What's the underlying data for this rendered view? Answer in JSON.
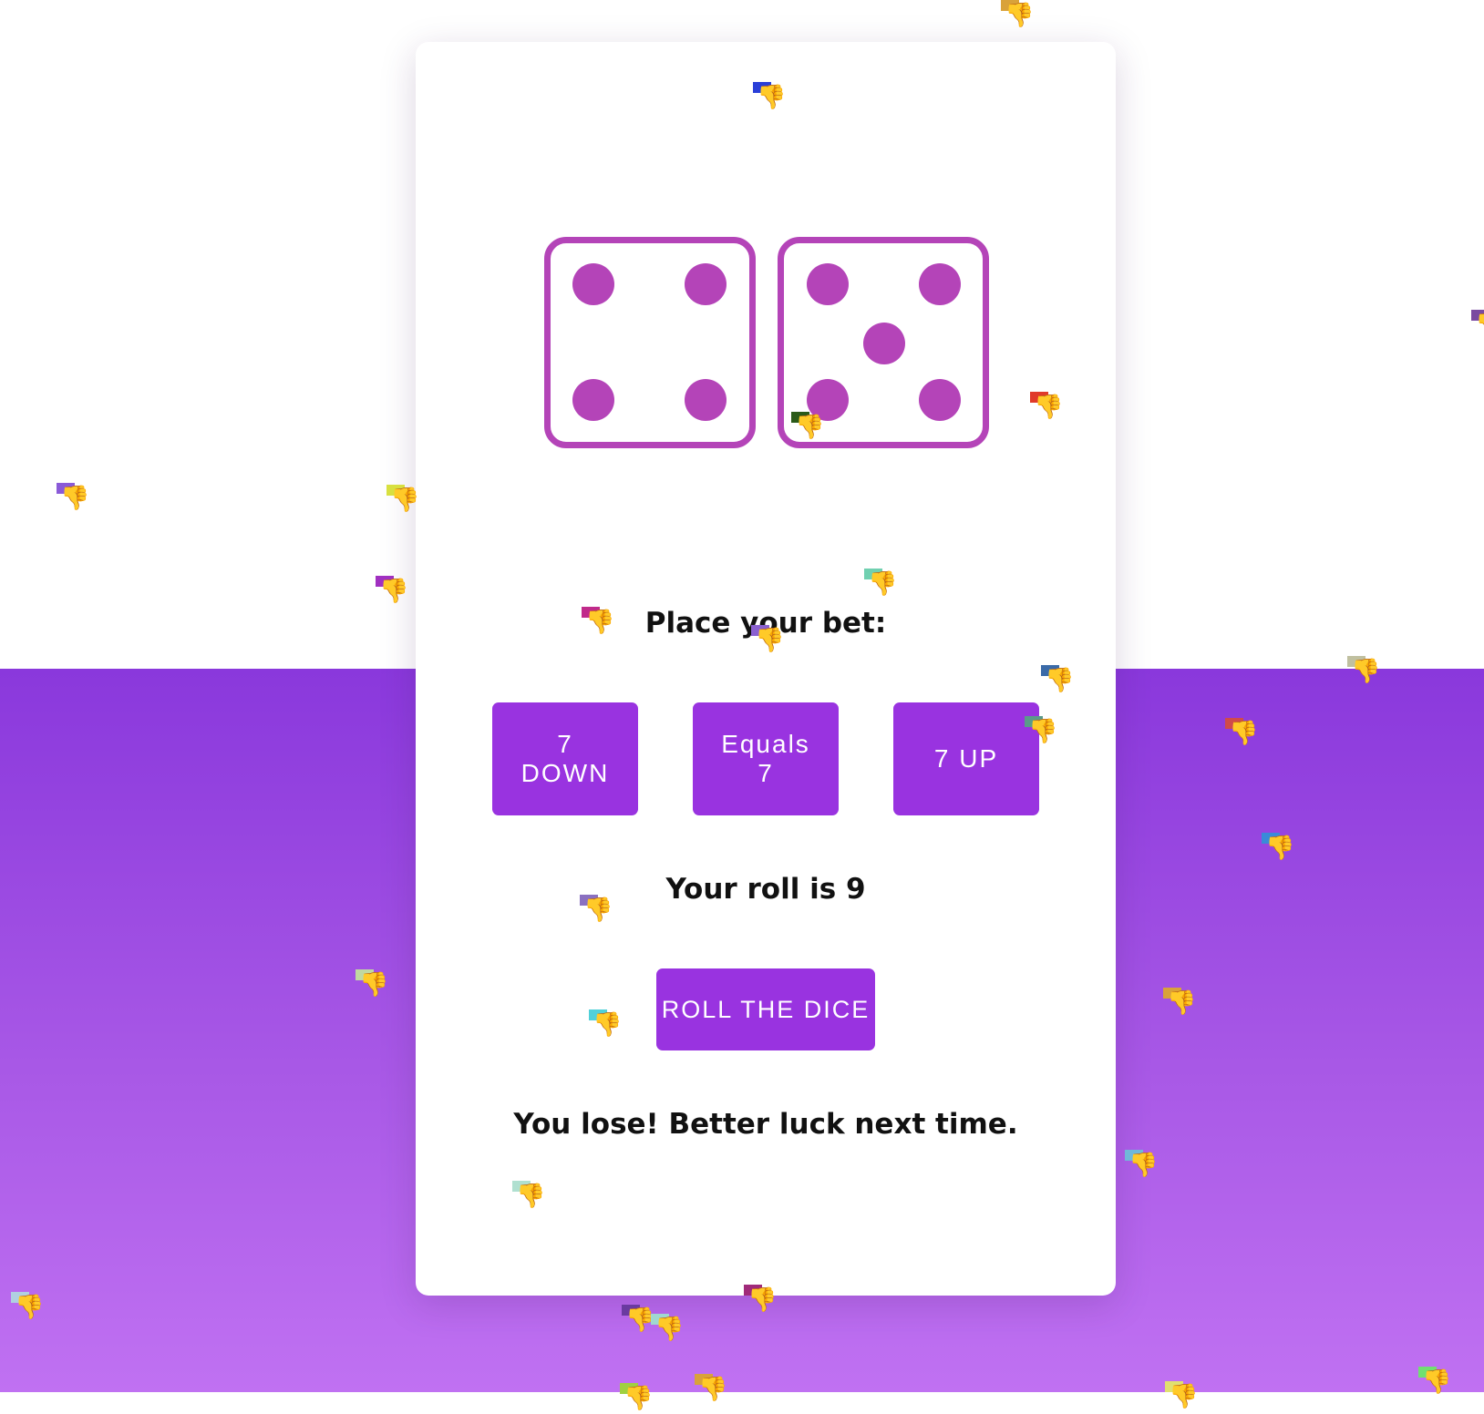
{
  "prompt": "Place your bet:",
  "bets": [
    {
      "label": "7 DOWN"
    },
    {
      "label": "Equals 7"
    },
    {
      "label": "7 UP"
    }
  ],
  "roll_text": "Your roll is 9",
  "roll_button": "ROLL THE DICE",
  "result": "You lose! Better luck next time.",
  "dice": [
    4,
    5
  ],
  "colors": {
    "accent": "#9933e0",
    "die": "#b444b8"
  },
  "confetti_icon": "thumbs-down-icon",
  "confetti_glyph": "👎"
}
